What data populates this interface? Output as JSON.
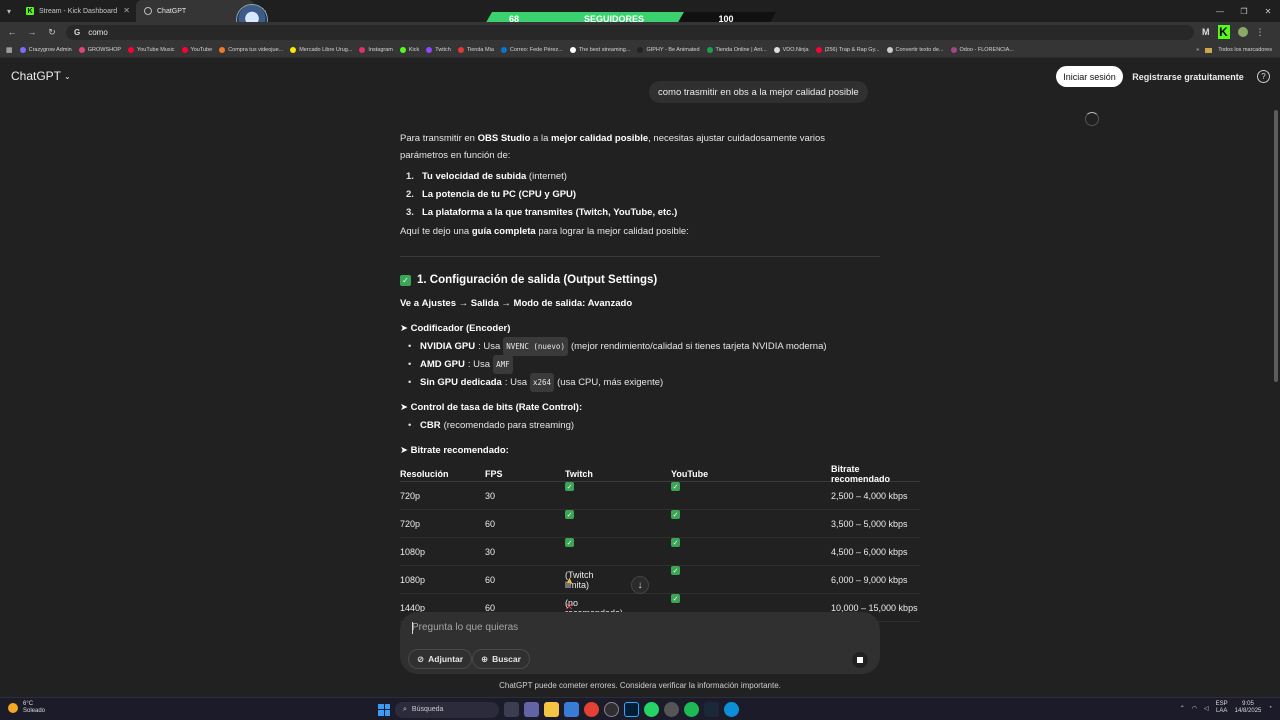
{
  "browser": {
    "tabs": [
      {
        "title": "Stream - Kick Dashboard",
        "active": false
      },
      {
        "title": "ChatGPT",
        "active": true
      }
    ],
    "address": "como",
    "bookmarks": [
      {
        "label": "Crazygrow Admin",
        "color": "#7b6cff"
      },
      {
        "label": "GROWSHOP",
        "color": "#e0457b"
      },
      {
        "label": "YouTube Music",
        "color": "#ff0033"
      },
      {
        "label": "YouTube",
        "color": "#ff0033"
      },
      {
        "label": "Compra tus videojue...",
        "color": "#f07a2a"
      },
      {
        "label": "Mercado Libre Urug...",
        "color": "#ffe600"
      },
      {
        "label": "Instagram",
        "color": "#e1306c"
      },
      {
        "label": "Kick",
        "color": "#53fc18"
      },
      {
        "label": "Twitch",
        "color": "#9146ff"
      },
      {
        "label": "Tienda Mia",
        "color": "#e53935"
      },
      {
        "label": "Correo: Fede Pérez...",
        "color": "#0078d4"
      },
      {
        "label": "The best streaming...",
        "color": "#ffffff"
      },
      {
        "label": "GIPHY - Be Animated",
        "color": "#222222"
      },
      {
        "label": "Tienda Online | Ant...",
        "color": "#16a34a"
      },
      {
        "label": "VDO.Ninja",
        "color": "#dddddd"
      },
      {
        "label": "(256) Trap & Rap Gy...",
        "color": "#ff0033"
      },
      {
        "label": "Convertir texto de...",
        "color": "#cccccc"
      },
      {
        "label": "Odoo - FLORENCIA...",
        "color": "#a24689"
      }
    ],
    "bookmarks_more": "»",
    "all_bookmarks": "Todos los marcadores"
  },
  "overlay": {
    "count": "68",
    "label": "SEGUIDORES",
    "goal": "100"
  },
  "app": {
    "brand": "ChatGPT",
    "login": "Iniciar sesión",
    "register": "Registrarse gratuitamente",
    "help": "?"
  },
  "chat": {
    "user_message": "como trasmitir en obs a la mejor calidad posible",
    "intro_a": "Para transmitir en ",
    "intro_b": "OBS Studio",
    "intro_c": " a la ",
    "intro_d": "mejor calidad posible",
    "intro_e": ", necesitas ajustar cuidadosamente varios parámetros en función de:",
    "steps": [
      {
        "n": "1.",
        "bold": "Tu velocidad de subida",
        "rest": " (internet)"
      },
      {
        "n": "2.",
        "bold": "La potencia de tu PC (CPU y GPU)",
        "rest": ""
      },
      {
        "n": "3.",
        "bold": "La plataforma a la que transmites (Twitch, YouTube, etc.)",
        "rest": ""
      }
    ],
    "guide_a": "Aquí te dejo una ",
    "guide_b": "guía completa",
    "guide_c": " para lograr la mejor calidad posible:",
    "section1_title": "1. Configuración de salida (Output Settings)",
    "path_a": "Ve a ",
    "path_b": "Ajustes → Salida → Modo de salida: Avanzado",
    "encoder_title": "➤ Codificador (Encoder)",
    "encoders": [
      {
        "bold": "NVIDIA GPU",
        "pre": ": Usa ",
        "code": "NVENC (nuevo)",
        "post": " (mejor rendimiento/calidad si tienes tarjeta NVIDIA moderna)"
      },
      {
        "bold": "AMD GPU",
        "pre": ": Usa ",
        "code": "AMF",
        "post": ""
      },
      {
        "bold": "Sin GPU dedicada",
        "pre": ": Usa ",
        "code": "x264",
        "post": " (usa CPU, más exigente)"
      }
    ],
    "rate_title": "➤ Control de tasa de bits (Rate Control):",
    "rate_item_bold": "CBR",
    "rate_item_rest": " (recomendado para streaming)",
    "bitrate_title": "➤ Bitrate recomendado:",
    "table": {
      "headers": [
        "Resolución",
        "FPS",
        "Twitch",
        "YouTube",
        "Bitrate recomendado"
      ],
      "rows": [
        {
          "res": "720p",
          "fps": "30",
          "twitch": "check",
          "twitch_text": "",
          "youtube": "check",
          "bitrate": "2,500 – 4,000 kbps"
        },
        {
          "res": "720p",
          "fps": "60",
          "twitch": "check",
          "twitch_text": "",
          "youtube": "check",
          "bitrate": "3,500 – 5,000 kbps"
        },
        {
          "res": "1080p",
          "fps": "30",
          "twitch": "check",
          "twitch_text": "",
          "youtube": "check",
          "bitrate": "4,500 – 6,000 kbps"
        },
        {
          "res": "1080p",
          "fps": "60",
          "twitch": "warn",
          "twitch_text": "(Twitch limita)",
          "youtube": "check",
          "bitrate": "6,000 – 9,000 kbps"
        },
        {
          "res": "1440p",
          "fps": "60",
          "twitch": "x",
          "twitch_text": "(no recomendado)",
          "youtube": "check",
          "bitrate": "10,000 – 15,000 kbps"
        }
      ]
    }
  },
  "composer": {
    "placeholder": "Pregunta lo que quieras",
    "attach": "Adjuntar",
    "search": "Buscar"
  },
  "disclaimer": "ChatGPT puede cometer errores. Considera verificar la información importante.",
  "taskbar": {
    "temp": "6°C",
    "weather": "Soleado",
    "search": "Búsqueda",
    "lang1": "ESP",
    "lang2": "LAA",
    "time": "9:05",
    "date": "14/8/2025"
  }
}
